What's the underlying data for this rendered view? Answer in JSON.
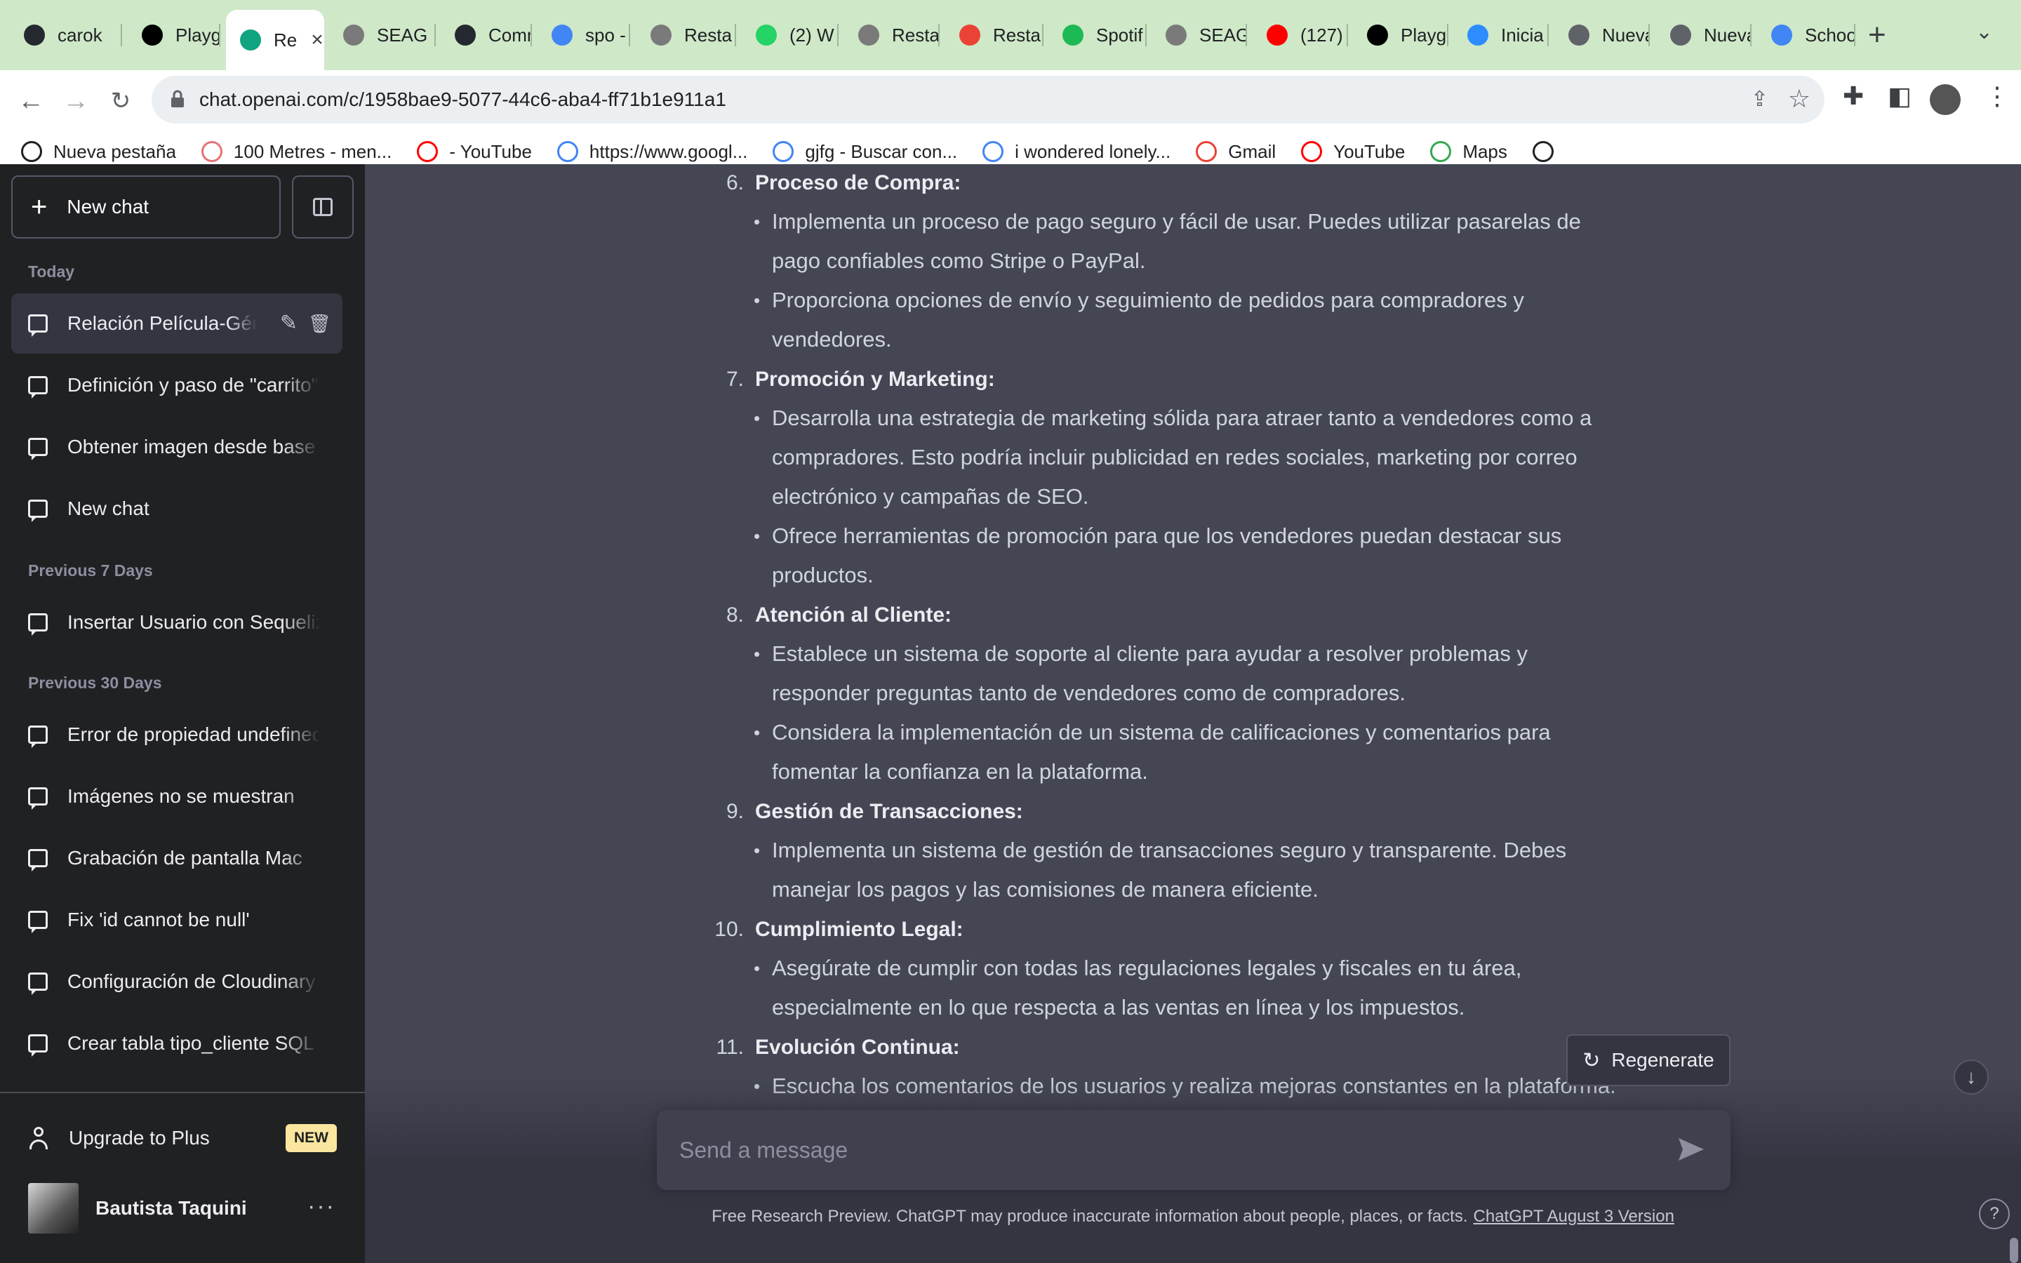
{
  "browser": {
    "tabs": [
      {
        "label": "carok",
        "icon": "github-icon",
        "color": "#24292f"
      },
      {
        "label": "Playg",
        "icon": "openai-dev-icon",
        "color": "#000000"
      },
      {
        "label": "Re",
        "icon": "openai-icon",
        "color": "#10a37f",
        "active": true
      },
      {
        "label": "SEAG",
        "icon": "globe-icon",
        "color": "#7a7a7a"
      },
      {
        "label": "Comm",
        "icon": "github-icon",
        "color": "#24292f"
      },
      {
        "label": "spo -",
        "icon": "google-icon",
        "color": "#4285f4"
      },
      {
        "label": "Resta",
        "icon": "globe-icon",
        "color": "#7a7a7a"
      },
      {
        "label": "(2) W",
        "icon": "whatsapp-icon",
        "color": "#25d366"
      },
      {
        "label": "Resta",
        "icon": "globe-icon",
        "color": "#7a7a7a"
      },
      {
        "label": "Resta",
        "icon": "gmail-icon",
        "color": "#ea4335"
      },
      {
        "label": "Spotif",
        "icon": "spotify-icon",
        "color": "#1db954"
      },
      {
        "label": "SEAG",
        "icon": "globe-icon",
        "color": "#7a7a7a"
      },
      {
        "label": "(127)",
        "icon": "youtube-icon",
        "color": "#ff0000"
      },
      {
        "label": "Playg",
        "icon": "openai-dev-icon",
        "color": "#000000"
      },
      {
        "label": "Inicia",
        "icon": "zoom-icon",
        "color": "#2d8cff"
      },
      {
        "label": "Nueva",
        "icon": "chrome-icon",
        "color": "#5f6368"
      },
      {
        "label": "Nueva",
        "icon": "chrome-icon",
        "color": "#5f6368"
      },
      {
        "label": "Schoo",
        "icon": "google-icon",
        "color": "#4285f4"
      }
    ],
    "url": "chat.openai.com/c/1958bae9-5077-44c6-aba4-ff71b1e911a1",
    "bookmarks": [
      {
        "label": "Nueva pestaña",
        "icon": "globe-icon",
        "color": "#202124"
      },
      {
        "label": "100 Metres - men...",
        "icon": "sprint-icon",
        "color": "#e57373"
      },
      {
        "label": "- YouTube",
        "icon": "youtube-icon",
        "color": "#ff0000"
      },
      {
        "label": "https://www.googl...",
        "icon": "google-icon",
        "color": "#4285f4"
      },
      {
        "label": "gjfg - Buscar con...",
        "icon": "google-icon",
        "color": "#4285f4"
      },
      {
        "label": "i wondered lonely...",
        "icon": "google-icon",
        "color": "#4285f4"
      },
      {
        "label": "Gmail",
        "icon": "gmail-icon",
        "color": "#ea4335"
      },
      {
        "label": "YouTube",
        "icon": "youtube-icon",
        "color": "#ff0000"
      },
      {
        "label": "Maps",
        "icon": "maps-icon",
        "color": "#34a853"
      },
      {
        "label": "",
        "icon": "globe-icon",
        "color": "#202124"
      }
    ]
  },
  "sidebar": {
    "new_chat": "New chat",
    "sections": {
      "today": "Today",
      "prev7": "Previous 7 Days",
      "prev30": "Previous 30 Days"
    },
    "today": [
      "Relación Película-Género",
      "Definición y paso de \"carrito\"",
      "Obtener imagen desde base",
      "New chat"
    ],
    "prev7": [
      "Insertar Usuario con Sequelize"
    ],
    "prev30": [
      "Error de propiedad undefined",
      "Imágenes no se muestran",
      "Grabación de pantalla Mac",
      "Fix 'id cannot be null'",
      "Configuración de Cloudinary",
      "Crear tabla tipo_cliente SQL"
    ],
    "upgrade": "Upgrade to Plus",
    "new_badge": "NEW",
    "user_name": "Bautista Taquini"
  },
  "answer": {
    "items": [
      {
        "num": "6.",
        "title": "Proceso de Compra:",
        "bullets": [
          [
            "Implementa un proceso de pago seguro y fácil de usar. Puedes utilizar pasarelas de",
            "pago confiables como Stripe o PayPal."
          ],
          [
            "Proporciona opciones de envío y seguimiento de pedidos para compradores y",
            "vendedores."
          ]
        ]
      },
      {
        "num": "7.",
        "title": "Promoción y Marketing:",
        "bullets": [
          [
            "Desarrolla una estrategia de marketing sólida para atraer tanto a vendedores como a",
            "compradores. Esto podría incluir publicidad en redes sociales, marketing por correo",
            "electrónico y campañas de SEO."
          ],
          [
            "Ofrece herramientas de promoción para que los vendedores puedan destacar sus",
            "productos."
          ]
        ]
      },
      {
        "num": "8.",
        "title": "Atención al Cliente:",
        "bullets": [
          [
            "Establece un sistema de soporte al cliente para ayudar a resolver problemas y",
            "responder preguntas tanto de vendedores como de compradores."
          ],
          [
            "Considera la implementación de un sistema de calificaciones y comentarios para",
            "fomentar la confianza en la plataforma."
          ]
        ]
      },
      {
        "num": "9.",
        "title": "Gestión de Transacciones:",
        "bullets": [
          [
            "Implementa un sistema de gestión de transacciones seguro y transparente. Debes",
            "manejar los pagos y las comisiones de manera eficiente."
          ]
        ]
      },
      {
        "num": "10.",
        "title": "Cumplimiento Legal:",
        "bullets": [
          [
            "Asegúrate de cumplir con todas las regulaciones legales y fiscales en tu área,",
            "especialmente en lo que respecta a las ventas en línea y los impuestos."
          ]
        ]
      },
      {
        "num": "11.",
        "title": "Evolución Continua:",
        "bullets": [
          [
            "Escucha los comentarios de los usuarios y realiza mejoras constantes en la plataforma."
          ]
        ]
      }
    ]
  },
  "composer": {
    "placeholder": "Send a message",
    "regenerate": "Regenerate"
  },
  "footer": {
    "disclaimer": "Free Research Preview. ChatGPT may produce inaccurate information about people, places, or facts.",
    "version_link": "ChatGPT August 3 Version"
  }
}
